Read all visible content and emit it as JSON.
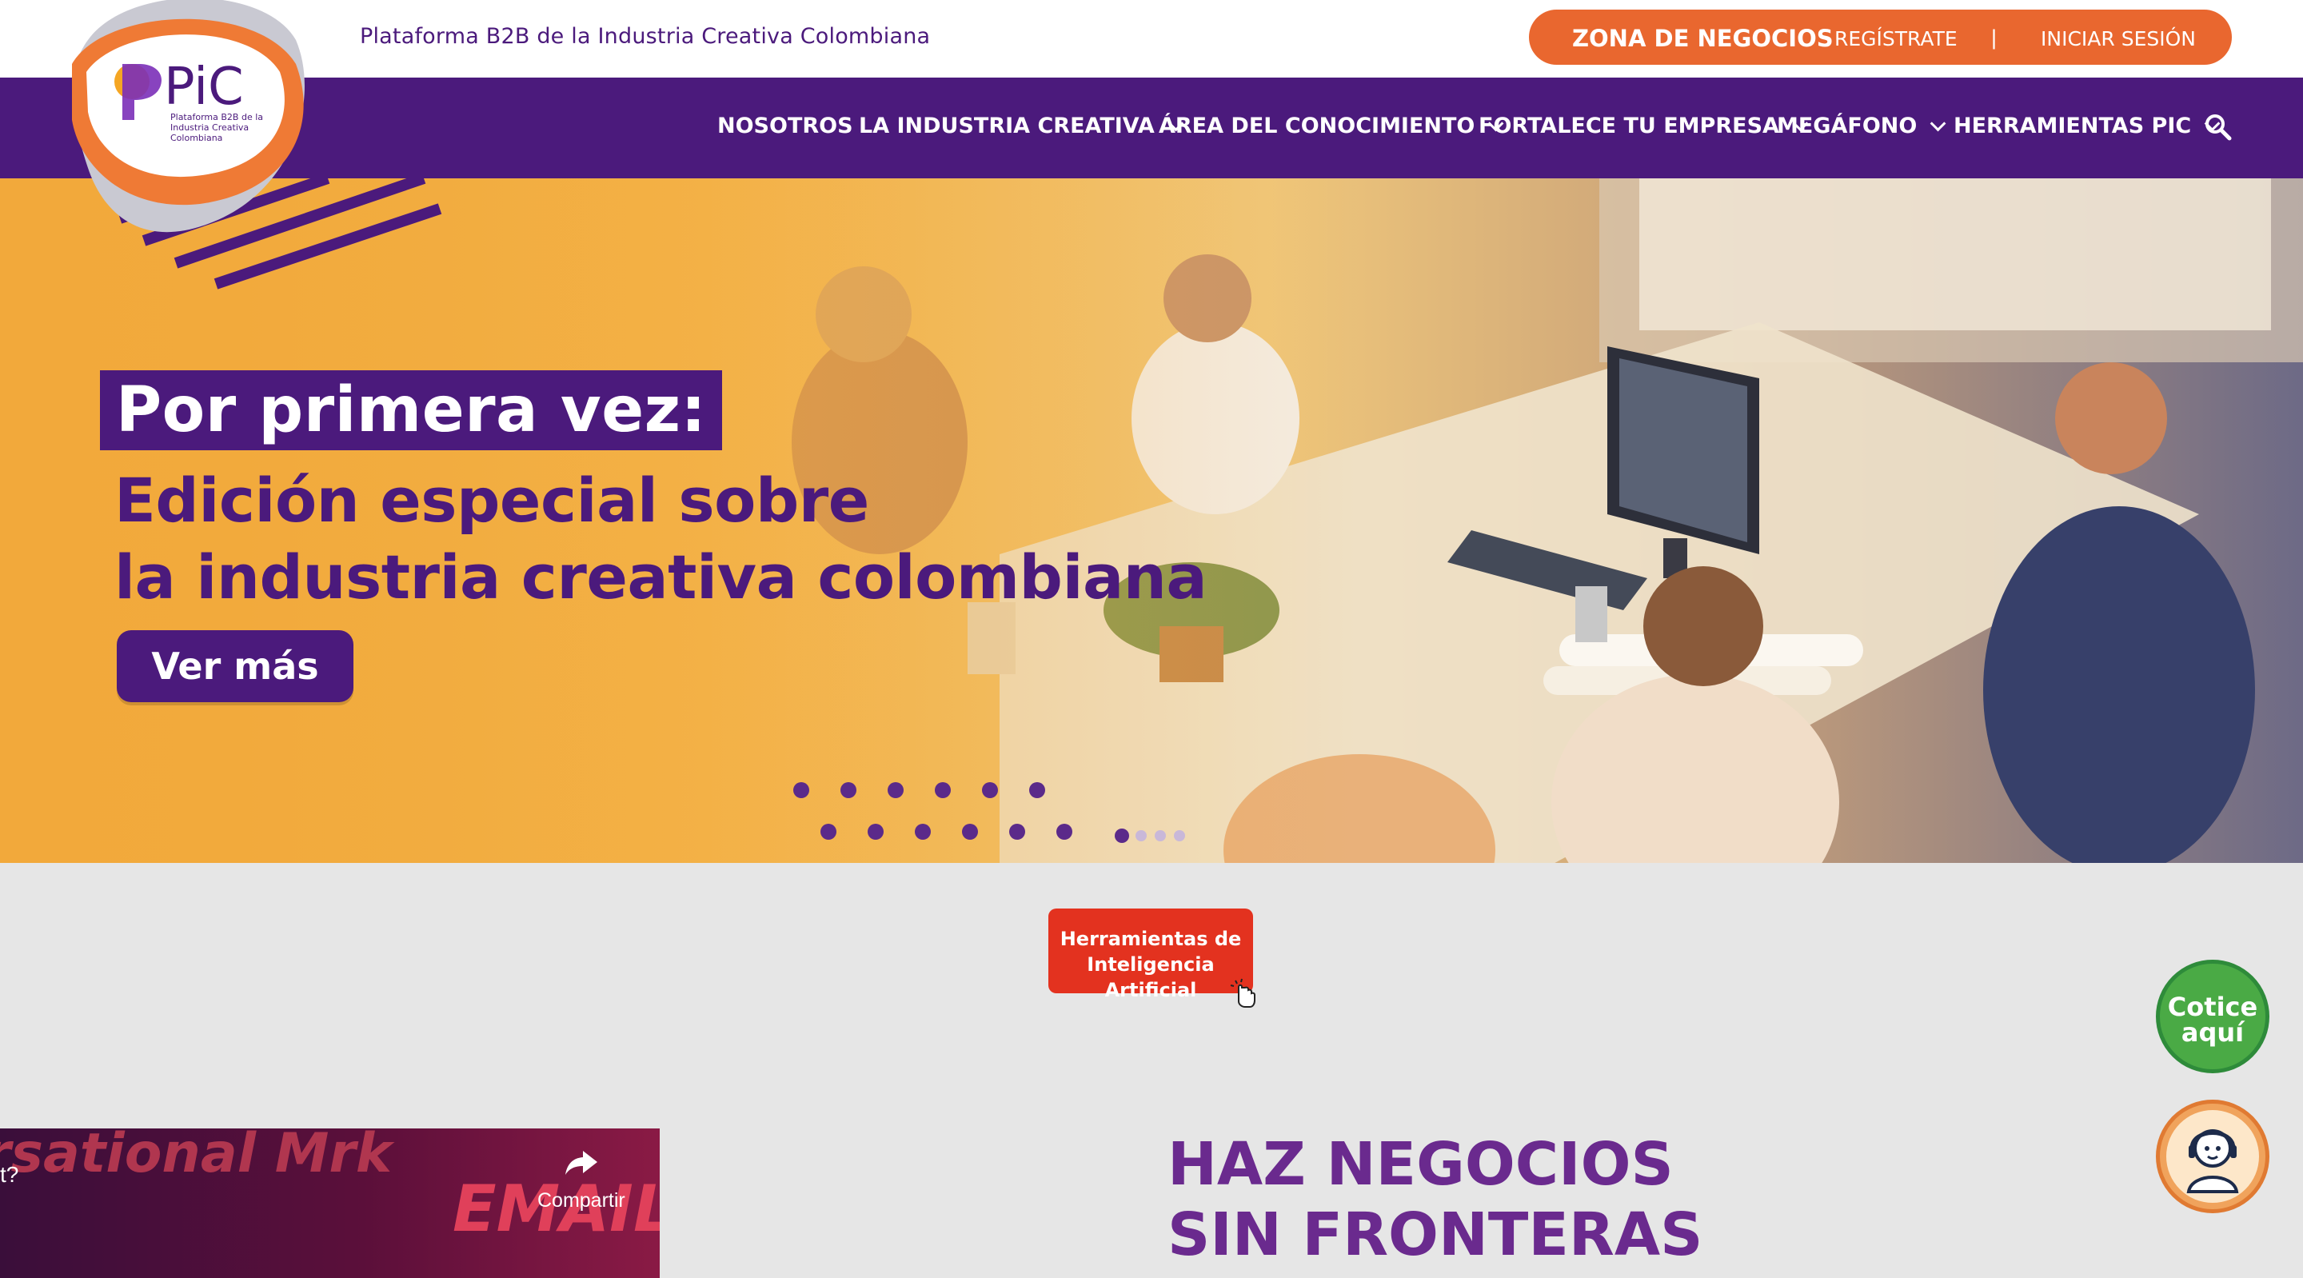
{
  "header": {
    "tagline": "Plataforma B2B de la Industria Creativa Colombiana",
    "zone_label": "ZONA DE NEGOCIOS",
    "register_label": "REGÍSTRATE",
    "separator": "|",
    "login_label": "INICIAR SESIÓN"
  },
  "logo": {
    "text": "PiC",
    "subtext": "Plataforma B2B de la Industria Creativa Colombiana"
  },
  "nav": {
    "items": [
      {
        "label": "NOSOTROS",
        "has_dropdown": false
      },
      {
        "label": "LA INDUSTRIA CREATIVA",
        "has_dropdown": true
      },
      {
        "label": "ÁREA DEL CONOCIMIENTO",
        "has_dropdown": true
      },
      {
        "label": "FORTALECE TU EMPRESA",
        "has_dropdown": true
      },
      {
        "label": "MEGÁFONO",
        "has_dropdown": true
      },
      {
        "label": "HERRAMIENTAS PIC",
        "has_dropdown": true
      }
    ],
    "search_icon": "search-icon"
  },
  "hero": {
    "title": "Por primera vez:",
    "subtitle_line1": "Edición especial sobre",
    "subtitle_line2": "la industria creativa colombiana",
    "cta_label": "Ver más",
    "slide_count": 4,
    "active_slide": 1
  },
  "ai_button": {
    "line1": "Herramientas de",
    "line2": "Inteligencia Artificial"
  },
  "cotice": {
    "line1": "Cotice",
    "line2": "aquí"
  },
  "video": {
    "title_fragment": "rsational Mrk",
    "question_fragment": "t?",
    "email_text": "EMAIL",
    "share_label": "Compartir"
  },
  "section": {
    "heading_line1": "HAZ NEGOCIOS",
    "heading_line2": "SIN FRONTERAS"
  },
  "colors": {
    "brand_purple": "#4b1a7c",
    "brand_orange": "#e9672f",
    "ai_red": "#e3321f",
    "cotice_green": "#4aaa45"
  }
}
